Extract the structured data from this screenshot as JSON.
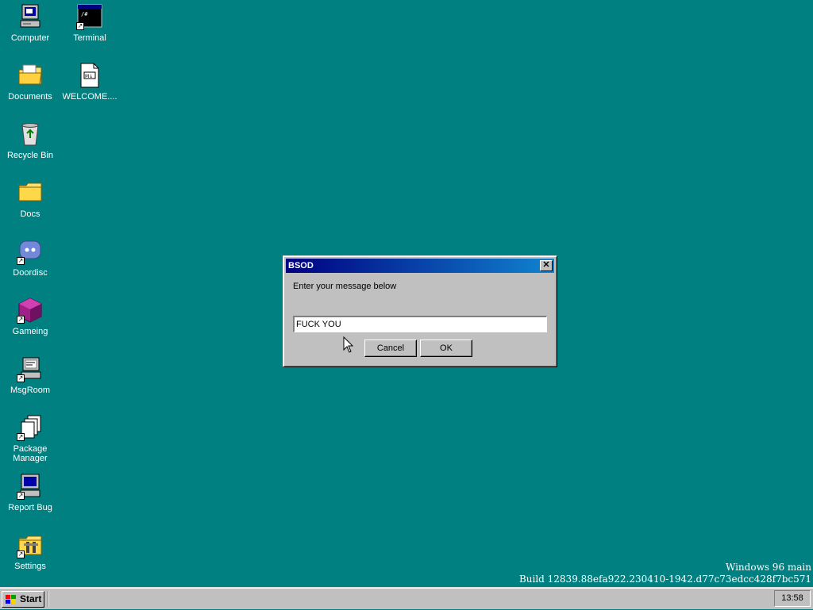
{
  "desktop": {
    "icons": [
      {
        "label": "Computer",
        "icon": "computer-icon",
        "shortcut": false
      },
      {
        "label": "Terminal",
        "icon": "terminal-icon",
        "shortcut": true
      },
      {
        "label": "Documents",
        "icon": "documents-folder-icon",
        "shortcut": false
      },
      {
        "label": "WELCOME....",
        "icon": "markdown-file-icon",
        "shortcut": false
      },
      {
        "label": "Recycle Bin",
        "icon": "recycle-bin-icon",
        "shortcut": false
      },
      {
        "label": "Docs",
        "icon": "folder-icon",
        "shortcut": false
      },
      {
        "label": "Doordisc",
        "icon": "doordisc-icon",
        "shortcut": true
      },
      {
        "label": "Gameing",
        "icon": "gameing-icon",
        "shortcut": true
      },
      {
        "label": "MsgRoom",
        "icon": "msgroom-icon",
        "shortcut": true
      },
      {
        "label": "Package Manager",
        "icon": "package-manager-icon",
        "shortcut": true
      },
      {
        "label": "Report Bug",
        "icon": "report-bug-icon",
        "shortcut": true
      },
      {
        "label": "Settings",
        "icon": "settings-icon",
        "shortcut": true
      }
    ]
  },
  "dialog": {
    "title": "BSOD",
    "message": "Enter your message below",
    "input_value": "FUCK YOU",
    "cancel_label": "Cancel",
    "ok_label": "OK",
    "close_glyph": "✕"
  },
  "watermark": {
    "line1": "Windows 96 main",
    "line2": "Build 12839.88efa922.230410-1942.d77c73edcc428f7bc571"
  },
  "taskbar": {
    "start_label": "Start",
    "clock": "13:58"
  },
  "colors": {
    "desktop": "#008080",
    "titlebar_start": "#000080",
    "titlebar_end": "#1084d0",
    "face": "#c0c0c0"
  }
}
